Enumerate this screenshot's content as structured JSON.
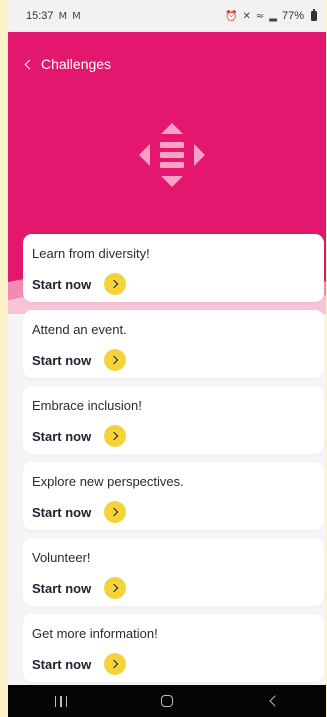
{
  "status_bar": {
    "time": "15:37",
    "notification_icons": [
      "gmail-icon",
      "gmail-icon"
    ],
    "status_icons": [
      "alarm-icon",
      "mute-icon",
      "wifi-icon",
      "signal-icon"
    ],
    "battery": "77%"
  },
  "header": {
    "back_label": "Challenges",
    "background_color": "#e3176d",
    "icon": "move-arrows-icon"
  },
  "challenges": [
    {
      "title": "Learn from diversity!",
      "action_label": "Start now"
    },
    {
      "title": "Attend an event.",
      "action_label": "Start now"
    },
    {
      "title": "Embrace inclusion!",
      "action_label": "Start now"
    },
    {
      "title": "Explore new perspectives.",
      "action_label": "Start now"
    },
    {
      "title": "Volunteer!",
      "action_label": "Start now"
    },
    {
      "title": "Get more information!",
      "action_label": "Start now"
    }
  ],
  "colors": {
    "accent": "#e3176d",
    "button": "#f5d23a"
  },
  "nav_bar": {
    "buttons": [
      "recents-icon",
      "home-icon",
      "back-icon"
    ]
  }
}
